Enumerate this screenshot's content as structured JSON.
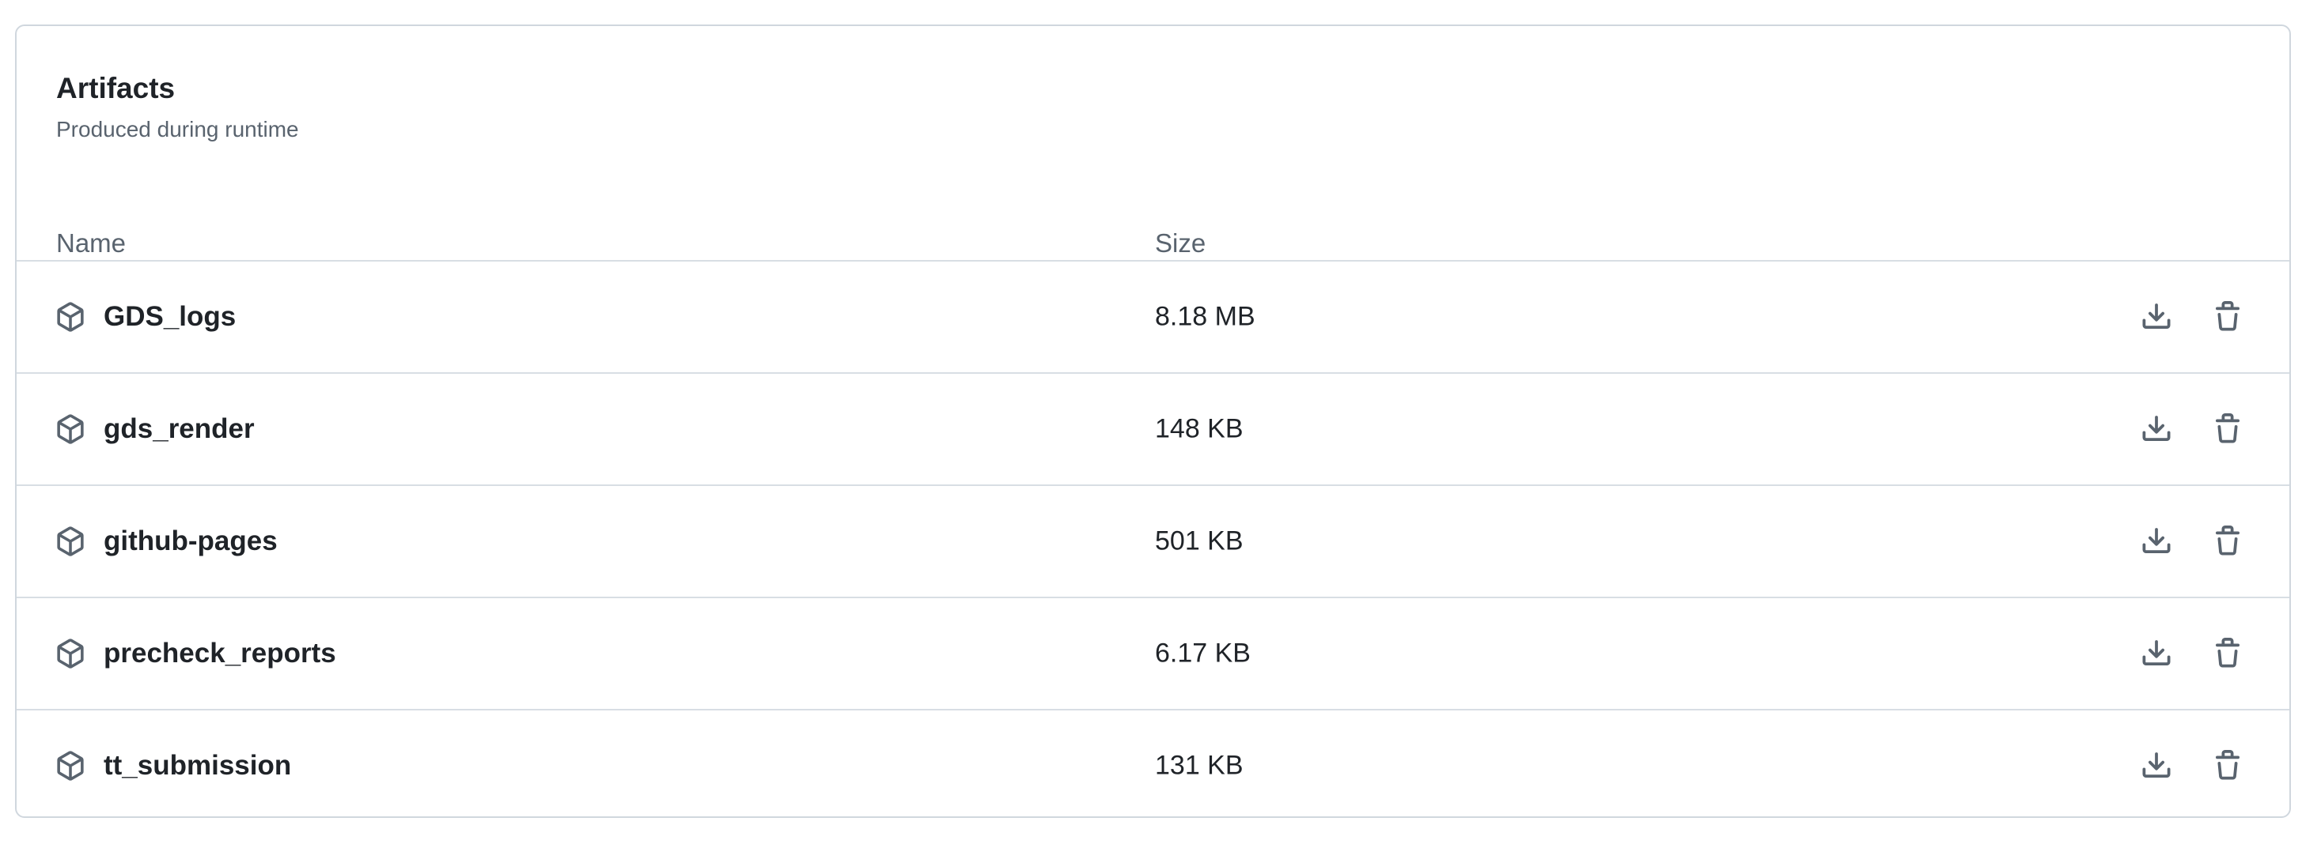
{
  "artifacts": {
    "title": "Artifacts",
    "subtitle": "Produced during runtime",
    "columns": {
      "name": "Name",
      "size": "Size"
    },
    "items": [
      {
        "name": "GDS_logs",
        "size": "8.18 MB",
        "icon": "package-icon"
      },
      {
        "name": "gds_render",
        "size": "148 KB",
        "icon": "package-icon"
      },
      {
        "name": "github-pages",
        "size": "501 KB",
        "icon": "package-icon"
      },
      {
        "name": "precheck_reports",
        "size": "6.17 KB",
        "icon": "package-icon"
      },
      {
        "name": "tt_submission",
        "size": "131 KB",
        "icon": "package-icon"
      }
    ],
    "actions": {
      "download_icon": "download-icon",
      "delete_icon": "trash-icon"
    }
  },
  "colors": {
    "text": "#1f2328",
    "muted": "#59636e",
    "border": "#d0d7de",
    "icon": "#59636e"
  }
}
